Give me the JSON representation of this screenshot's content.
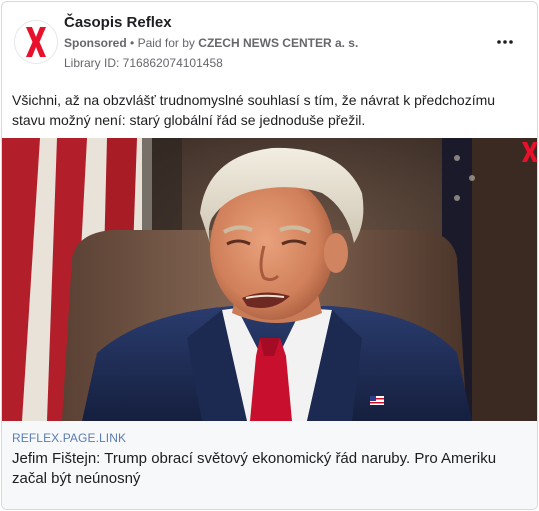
{
  "ad": {
    "page_name": "Časopis Reflex",
    "sponsored": "Sponsored",
    "separator": "•",
    "paid_for_prefix": "Paid for by",
    "advertiser": "CZECH NEWS CENTER a. s.",
    "library_id": "Library ID: 716862074101458",
    "more_icon": "more-horizontal-icon",
    "body": "Všichni, až na obzvlášť trudnomyslné souhlasí s tím, že návrat k předchozímu stavu možný není: starý globální řád se jednoduše přežil."
  },
  "link": {
    "domain": "REFLEX.PAGE.LINK",
    "title": "Jefim Fištejn: Trump obrací světový ekonomický řád naruby. Pro Ameriku začal být neúnosný"
  },
  "colors": {
    "brand_red": "#e8102a",
    "link_domain": "#5b7db1",
    "suit": "#1f2f5a",
    "tie": "#c8102e"
  }
}
